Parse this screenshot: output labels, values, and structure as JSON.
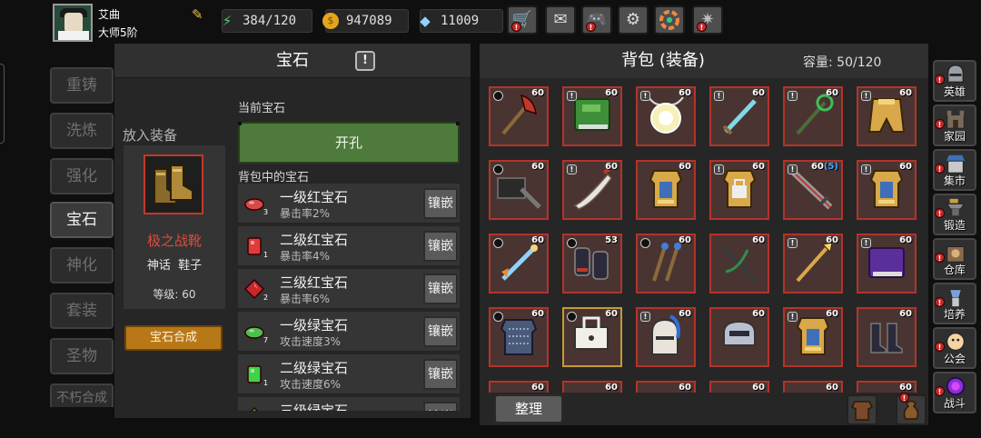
{
  "player": {
    "name": "艾曲",
    "rank": "大师5阶"
  },
  "resources": {
    "stamina": "384/120",
    "gold": "947089",
    "gems": "11009"
  },
  "toolbar": [
    "shop-cart-icon",
    "mail-icon",
    "gamepad-icon",
    "gear-icon",
    "color-wheel-icon",
    "firework-icon"
  ],
  "side_tabs": [
    "重铸",
    "洗炼",
    "强化",
    "宝石",
    "神化",
    "套装",
    "圣物",
    "不朽合成"
  ],
  "gem_panel": {
    "title": "宝石",
    "help": "!",
    "equip_label": "放入装备",
    "equip_name": "极之战靴",
    "equip_quality": "神话",
    "equip_type": "鞋子",
    "equip_level": "等级: 60",
    "synth_button": "宝石合成",
    "current_gem_label": "当前宝石",
    "hole_button": "开孔",
    "bag_gems_label": "背包中的宝石",
    "inlay_label": "镶嵌",
    "gems": [
      {
        "name": "一级红宝石",
        "stat": "暴击率2%",
        "count": "3",
        "color": "#d84a4a",
        "shape": "oval"
      },
      {
        "name": "二级红宝石",
        "stat": "暴击率4%",
        "count": "1",
        "color": "#e23a3a",
        "shape": "rect"
      },
      {
        "name": "三级红宝石",
        "stat": "暴击率6%",
        "count": "2",
        "color": "#c9272d",
        "shape": "diamond"
      },
      {
        "name": "一级绿宝石",
        "stat": "攻击速度3%",
        "count": "7",
        "color": "#4cbf4c",
        "shape": "oval"
      },
      {
        "name": "二级绿宝石",
        "stat": "攻击速度6%",
        "count": "1",
        "color": "#3fd24a",
        "shape": "rect"
      },
      {
        "name": "三级绿宝石",
        "stat": "",
        "count": "",
        "color": "#2fb83c",
        "shape": "diamond"
      }
    ]
  },
  "backpack": {
    "title": "背包 (装备)",
    "capacity": "容量: 50/120",
    "sort_button": "整理",
    "items": [
      {
        "icon": "red-axe-icon",
        "level": "60",
        "mark": "o"
      },
      {
        "icon": "green-book-icon",
        "level": "60",
        "mark": "!"
      },
      {
        "icon": "glowing-orb-icon",
        "level": "60",
        "mark": "!"
      },
      {
        "icon": "cyan-sword-icon",
        "level": "60",
        "mark": "!"
      },
      {
        "icon": "green-staff-icon",
        "level": "60",
        "mark": "!"
      },
      {
        "icon": "gold-cloak-icon",
        "level": "60",
        "mark": "!"
      },
      {
        "icon": "iron-hammer-icon",
        "level": "60",
        "mark": "o"
      },
      {
        "icon": "bone-dagger-icon",
        "level": "60",
        "mark": "!"
      },
      {
        "icon": "gold-armor-icon",
        "level": "60",
        "mark": ""
      },
      {
        "icon": "lock-armor-icon",
        "level": "60",
        "mark": "!"
      },
      {
        "icon": "great-sword-icon",
        "level": "60",
        "plus": "(5)",
        "mark": "!"
      },
      {
        "icon": "gold-armor-icon",
        "level": "60",
        "mark": "!"
      },
      {
        "icon": "fire-sword-icon",
        "level": "60",
        "mark": "o"
      },
      {
        "icon": "dark-gauntlets-icon",
        "level": "53",
        "mark": "o"
      },
      {
        "icon": "twin-wands-icon",
        "level": "60",
        "mark": "o"
      },
      {
        "icon": "crossbow-icon",
        "level": "60",
        "mark": ""
      },
      {
        "icon": "gold-spear-icon",
        "level": "60",
        "mark": "!"
      },
      {
        "icon": "purple-book-icon",
        "level": "60",
        "mark": "!"
      },
      {
        "icon": "chain-vest-icon",
        "level": "60",
        "mark": "o"
      },
      {
        "icon": "skull-lock-icon",
        "level": "60",
        "mark": "o",
        "gold": true
      },
      {
        "icon": "blue-helm-icon",
        "level": "60",
        "mark": "!"
      },
      {
        "icon": "silver-helm-icon",
        "level": "60",
        "mark": ""
      },
      {
        "icon": "gold-armor-icon",
        "level": "60",
        "mark": "!"
      },
      {
        "icon": "dark-boots-icon",
        "level": "60",
        "mark": ""
      },
      {
        "icon": "item-icon",
        "level": "60",
        "mark": ""
      },
      {
        "icon": "item-icon",
        "level": "60",
        "mark": ""
      },
      {
        "icon": "item-icon",
        "level": "60",
        "mark": ""
      },
      {
        "icon": "item-icon",
        "level": "60",
        "mark": ""
      },
      {
        "icon": "item-icon",
        "level": "60",
        "mark": ""
      },
      {
        "icon": "item-icon",
        "level": "60",
        "mark": ""
      }
    ]
  },
  "right_menu": [
    {
      "label": "英雄",
      "icon": "hero-helmet-icon"
    },
    {
      "label": "家园",
      "icon": "castle-icon"
    },
    {
      "label": "集市",
      "icon": "market-icon"
    },
    {
      "label": "锻造",
      "icon": "anvil-icon"
    },
    {
      "label": "仓库",
      "icon": "warehouse-icon"
    },
    {
      "label": "培养",
      "icon": "cultivate-icon"
    },
    {
      "label": "公会",
      "icon": "guild-icon"
    },
    {
      "label": "战斗",
      "icon": "battle-portal-icon"
    }
  ]
}
